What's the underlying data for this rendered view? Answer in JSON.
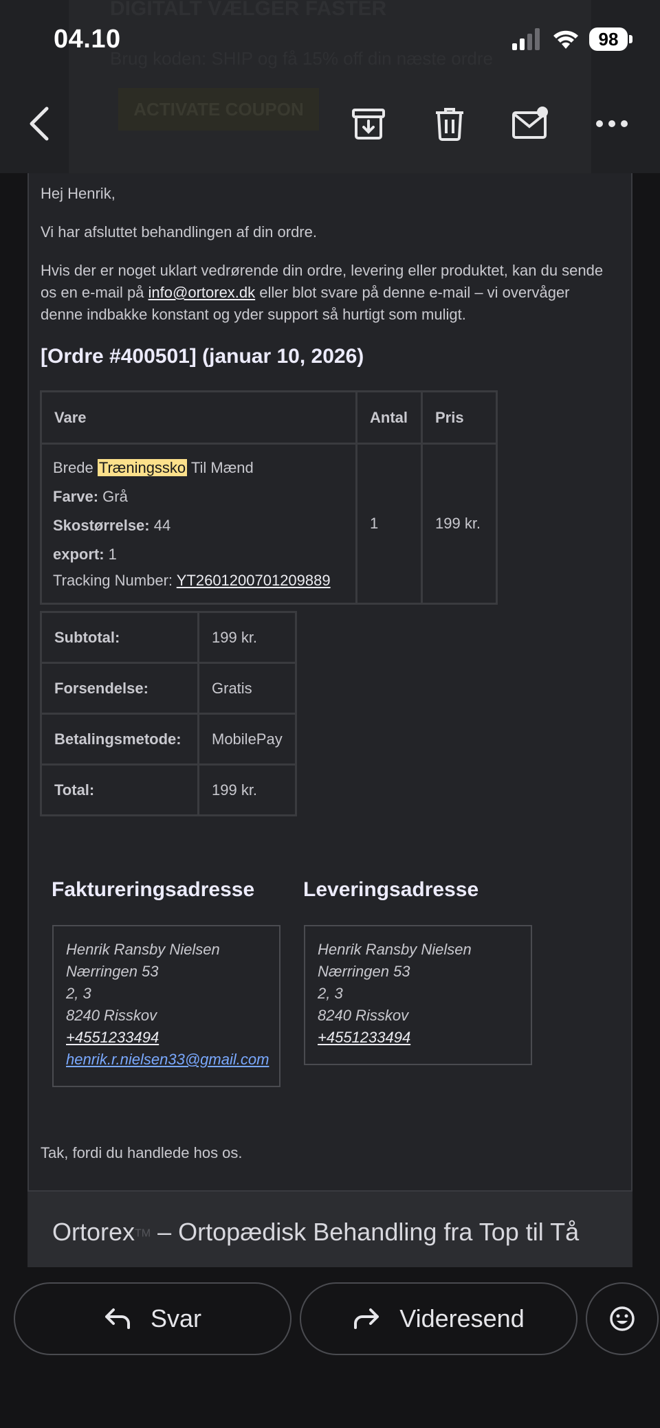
{
  "status": {
    "time": "04.10",
    "battery": "98"
  },
  "toolbar": {
    "back": "back",
    "archive": "archive",
    "delete": "delete",
    "mark_unread": "mark unread",
    "more": "more"
  },
  "ghost_banner": {
    "headline": "DIGITALT VÆLGER FASTER",
    "subline": "Brug koden: SHIP og få 15% off din næste ordre",
    "button": "ACTIVATE COUPON"
  },
  "email": {
    "greeting": "Hej Henrik,",
    "intro": "Vi har afsluttet behandlingen af din ordre.",
    "body_before_link": "Hvis der er noget uklart vedrørende din ordre, levering eller produktet, kan du sende os en e-mail på ",
    "email_link": "info@ortorex.dk",
    "body_after_link": " eller blot svare på denne e-mail – vi overvåger denne indbakke konstant og yder support så hurtigt som muligt.",
    "order_heading": "[Ordre #400501] (januar 10, 2026)",
    "table_headers": {
      "item": "Vare",
      "qty": "Antal",
      "price": "Pris"
    },
    "product": {
      "name_before": "Brede ",
      "name_highlight": "Træningssko",
      "name_after": " Til Mænd",
      "color_label": "Farve:",
      "color_value": " Grå",
      "size_label": "Skostørrelse:",
      "size_value": " 44",
      "export_label": "export:",
      "export_value": " 1",
      "tracking_label": "Tracking Number: ",
      "tracking_number": "YT2601200701209889",
      "qty": "1",
      "price": "199 kr."
    },
    "totals": [
      {
        "label": "Subtotal:",
        "value": "199 kr."
      },
      {
        "label": "Forsendelse:",
        "value": "Gratis"
      },
      {
        "label": "Betalingsmetode:",
        "value": "MobilePay"
      },
      {
        "label": "Total:",
        "value": "199 kr."
      }
    ],
    "billing": {
      "heading": "Faktureringsadresse",
      "name": "Henrik Ransby Nielsen",
      "street": "Nærringen 53",
      "unit": "2, 3",
      "city": "8240 Risskov",
      "phone": "+4551233494",
      "email": "henrik.r.nielsen33@gmail.com"
    },
    "shipping": {
      "heading": "Leveringsadresse",
      "name": "Henrik Ransby Nielsen",
      "street": "Nærringen 53",
      "unit": "2, 3",
      "city": "8240 Risskov",
      "phone": "+4551233494"
    },
    "thanks": "Tak, fordi du handlede hos os."
  },
  "footer": {
    "brand": "Ortorex",
    "tm": "TM",
    "tagline": " – Ortopædisk Behandling fra Top til Tå"
  },
  "actions": {
    "reply": "Svar",
    "forward": "Videresend",
    "emoji": "emoji"
  }
}
